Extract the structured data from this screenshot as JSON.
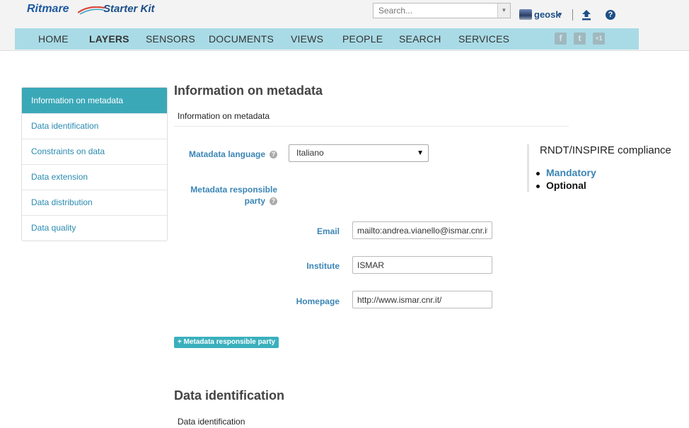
{
  "brand": {
    "name": "Ritmare",
    "product": "Starter Kit"
  },
  "search": {
    "placeholder": "Search..."
  },
  "user": {
    "name": "geosk"
  },
  "nav": [
    "HOME",
    "LAYERS",
    "SENSORS",
    "DOCUMENTS",
    "VIEWS",
    "PEOPLE",
    "SEARCH",
    "SERVICES"
  ],
  "nav_active": "LAYERS",
  "social": [
    "f",
    "t",
    "+1"
  ],
  "sidebar": {
    "items": [
      "Information on metadata",
      "Data identification",
      "Constraints on data",
      "Data extension",
      "Data distribution",
      "Data quality"
    ],
    "active": "Information on metadata"
  },
  "section1": {
    "title": "Information on metadata",
    "subtitle": "Information on metadata",
    "lang_label": "Matadata language",
    "lang_value": "Italiano",
    "party_label_1": "Metadata responsible",
    "party_label_2": "party",
    "email_label": "Email",
    "email_value": "mailto:andrea.vianello@ismar.cnr.it",
    "institute_label": "Institute",
    "institute_value": "ISMAR",
    "homepage_label": "Homepage",
    "homepage_value": "http://www.ismar.cnr.it/",
    "add_button": "+ Metadata responsible party"
  },
  "compliance": {
    "title": "RNDT/INSPIRE compliance",
    "mandatory": "Mandatory",
    "optional": "Optional",
    "colors": {
      "mandatory": "#3a85b5",
      "optional": "#111111"
    }
  },
  "section2": {
    "title": "Data identification",
    "subtitle": "Data identification"
  },
  "colors": {
    "navbar": "#a9dbe6",
    "accent": "#3ba8b8",
    "link": "#2a8bb0"
  }
}
